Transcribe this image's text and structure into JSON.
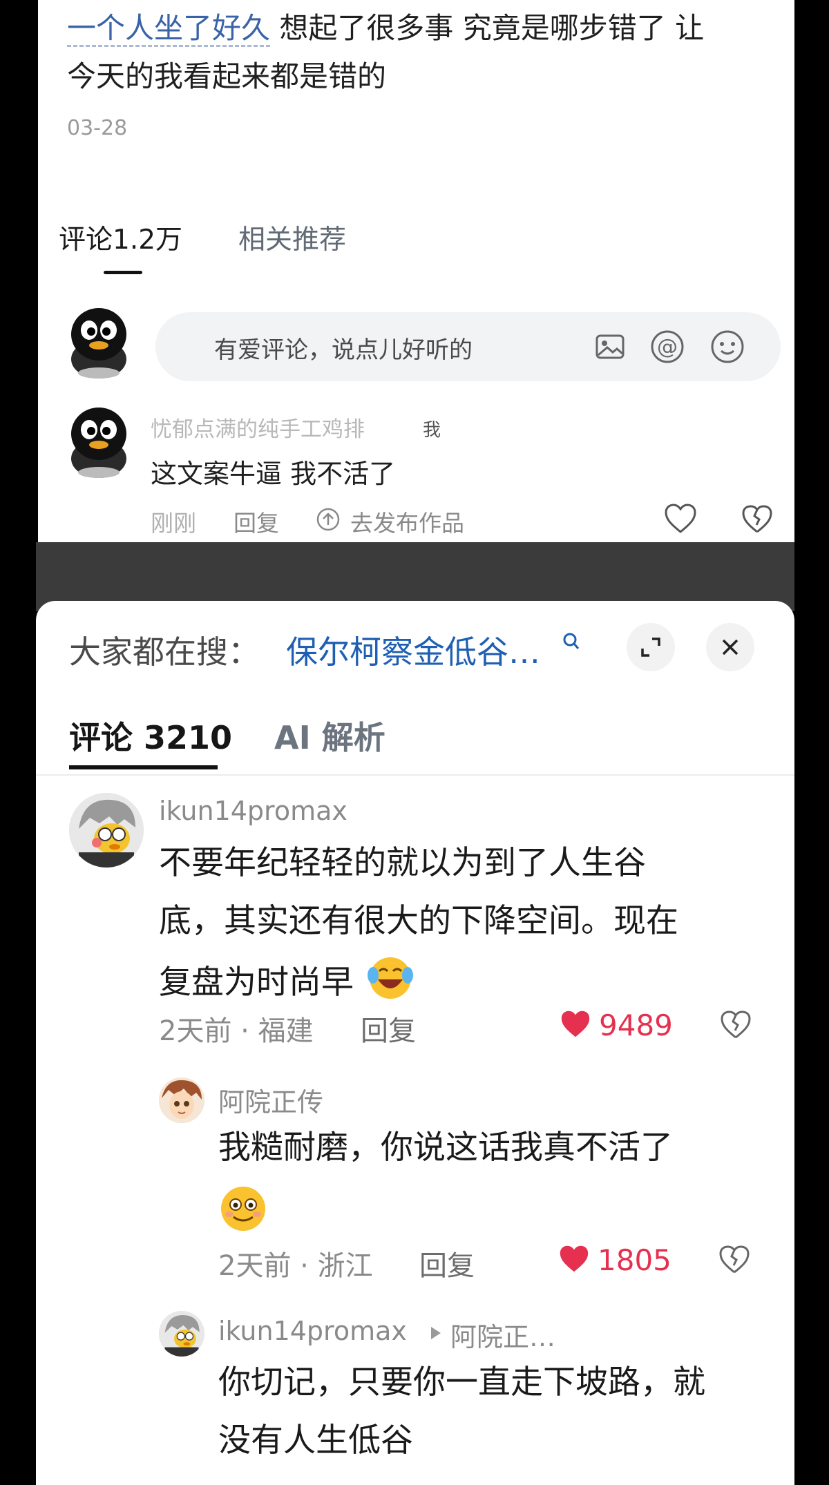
{
  "top": {
    "post_link_text": "一个人坐了好久",
    "post_text_line1_rest": " 想起了很多事 究竟是哪步错了 让",
    "post_text_line2": "今天的我看起来都是错的",
    "date": "03-28",
    "tabs": {
      "comments": "评论1.2万",
      "related": "相关推荐"
    },
    "input_placeholder": "有爱评论，说点儿好听的",
    "comment": {
      "user": "忧郁点满的纯手工鸡排",
      "me_tag": "我",
      "text": "这文案牛逼 我不活了",
      "time": "刚刚",
      "reply": "回复",
      "publish": "去发布作品"
    }
  },
  "bottom": {
    "search_label": "大家都在搜：",
    "search_term": "保尔柯察金低谷…",
    "tabs": {
      "comments": "评论 3210",
      "ai": "AI 解析"
    },
    "comments": [
      {
        "user": "ikun14promax",
        "line1": "不要年纪轻轻的就以为到了人生谷",
        "line2": "底，其实还有很大的下降空间。现在",
        "line3": "复盘为时尚早",
        "meta": "2天前 · 福建",
        "reply": "回复",
        "likes": "9489"
      },
      {
        "user": "阿院正传",
        "line1": "我糙耐磨，你说这话我真不活了",
        "meta": "2天前 · 浙江",
        "reply": "回复",
        "likes": "1805"
      },
      {
        "user": "ikun14promax",
        "reply_to": "阿院正…",
        "line1": "你切记，只要你一直走下坡路，就",
        "line2": "没有人生低谷"
      }
    ]
  },
  "colors": {
    "link_blue": "#3a63a7",
    "search_blue": "#1e5fb3",
    "like_red": "#e6304f"
  }
}
